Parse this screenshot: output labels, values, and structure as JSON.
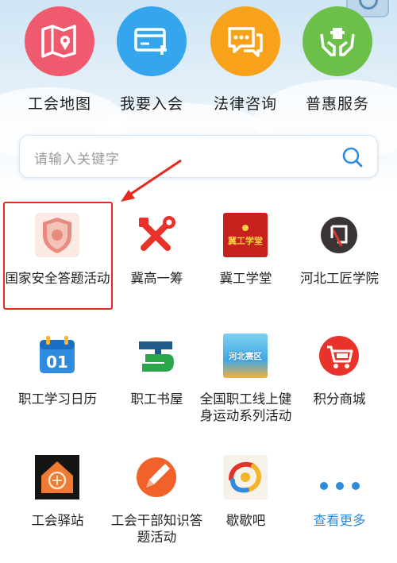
{
  "top_menu": [
    {
      "label": "工会地图",
      "icon": "map-icon",
      "color": "#f05a6e"
    },
    {
      "label": "我要入会",
      "icon": "card-icon",
      "color": "#35a5ee"
    },
    {
      "label": "法律咨询",
      "icon": "chat-icon",
      "color": "#f8a21c"
    },
    {
      "label": "普惠服务",
      "icon": "gift-hands-icon",
      "color": "#6cc04a"
    }
  ],
  "search": {
    "placeholder": "请输入关键字"
  },
  "grid": [
    {
      "label": "国家安全答题活动",
      "icon": "shield-badge-icon"
    },
    {
      "label": "冀高一筹",
      "icon": "tools-icon"
    },
    {
      "label": "冀工学堂",
      "icon": "school-emblem-icon",
      "text": "冀工学堂"
    },
    {
      "label": "河北工匠学院",
      "icon": "craftsman-logo-icon"
    },
    {
      "label": "职工学习日历",
      "icon": "calendar-icon",
      "text": "01"
    },
    {
      "label": "职工书屋",
      "icon": "book-logo-icon"
    },
    {
      "label": "全国职工线上健身运动系列活动",
      "icon": "fitness-banner-icon",
      "text": "河北赛区"
    },
    {
      "label": "积分商城",
      "icon": "shopping-cart-icon"
    },
    {
      "label": "工会驿站",
      "icon": "station-house-icon"
    },
    {
      "label": "工会干部知识答题活动",
      "icon": "pen-icon"
    },
    {
      "label": "歇歇吧",
      "icon": "rest-logo-icon"
    },
    {
      "label": "查看更多",
      "icon": "more-dots-icon"
    }
  ],
  "colors": {
    "accent": "#2f8bdc",
    "highlight": "#e5291e"
  }
}
